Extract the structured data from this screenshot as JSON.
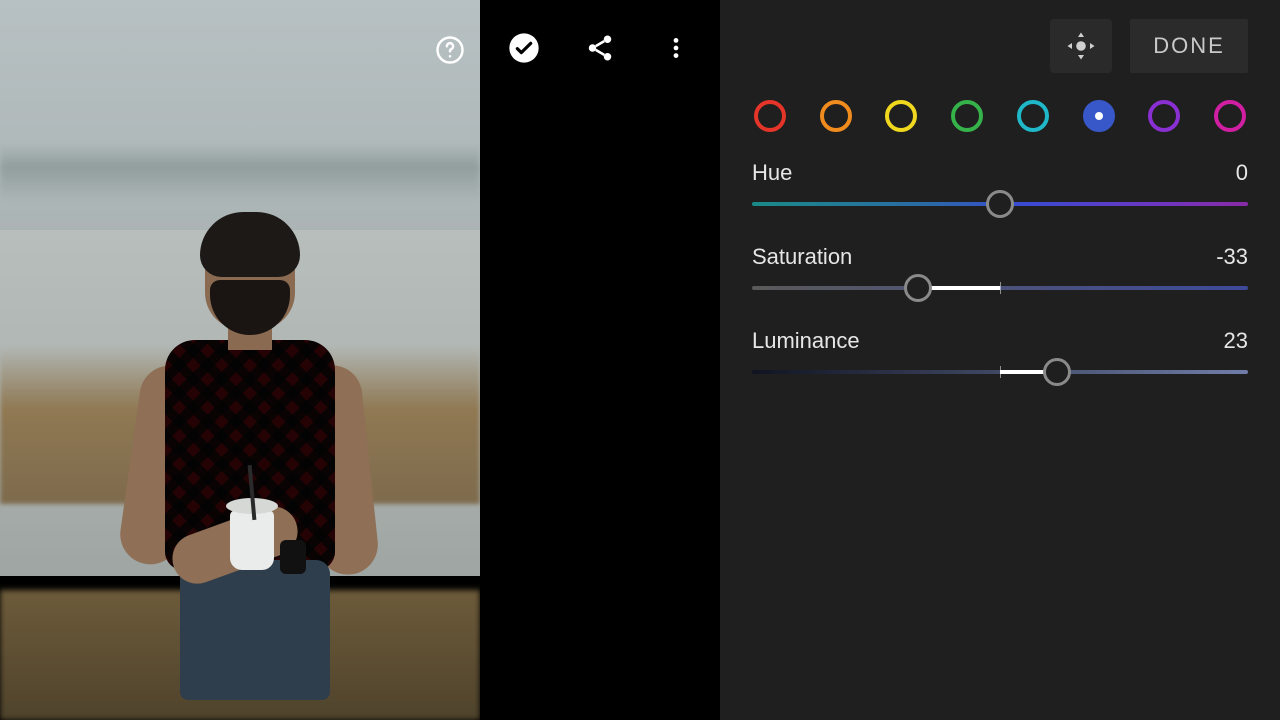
{
  "toolbar": {
    "help_icon": "help",
    "confirm_icon": "check-circle",
    "share_icon": "share",
    "overflow_icon": "more-vert"
  },
  "edit_header": {
    "pan_icon": "pan-move",
    "done_label": "DONE"
  },
  "color_mix": {
    "colors": [
      {
        "name": "red",
        "hex": "#e53528"
      },
      {
        "name": "orange",
        "hex": "#f08c1e"
      },
      {
        "name": "yellow",
        "hex": "#f0d81e"
      },
      {
        "name": "green",
        "hex": "#36b24a"
      },
      {
        "name": "aqua",
        "hex": "#1fb8c9"
      },
      {
        "name": "blue",
        "hex": "#3858c9"
      },
      {
        "name": "purple",
        "hex": "#8a2fd1"
      },
      {
        "name": "magenta",
        "hex": "#d11fa3"
      }
    ],
    "selected_index": 5
  },
  "sliders": {
    "hue": {
      "label": "Hue",
      "value": 0,
      "min": -100,
      "max": 100
    },
    "saturation": {
      "label": "Saturation",
      "value": -33,
      "min": -100,
      "max": 100
    },
    "luminance": {
      "label": "Luminance",
      "value": 23,
      "min": -100,
      "max": 100
    }
  }
}
